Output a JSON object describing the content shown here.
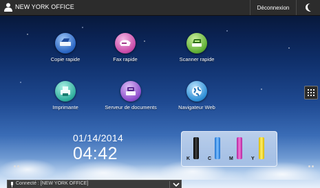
{
  "topbar": {
    "title": "NEW YORK OFFICE",
    "logout_label": "Déconnexion",
    "icons": {
      "user": "user-icon",
      "energy": "moon-icon"
    }
  },
  "apps": [
    {
      "label": "Copie rapide",
      "icon": "copy-icon"
    },
    {
      "label": "Fax rapide",
      "icon": "fax-icon"
    },
    {
      "label": "Scanner rapide",
      "icon": "scanner-icon"
    },
    {
      "label": "Imprimante",
      "icon": "printer-icon"
    },
    {
      "label": "Serveur de documents",
      "icon": "document-server-icon"
    },
    {
      "label": "Navigateur Web",
      "icon": "web-browser-icon"
    }
  ],
  "clock": {
    "date": "01/14/2014",
    "time": "04:42"
  },
  "toner": [
    {
      "label": "K",
      "color": "#000000"
    },
    {
      "label": "C",
      "color": "#1a6fcf"
    },
    {
      "label": "M",
      "color": "#c52ba7"
    },
    {
      "label": "Y",
      "color": "#e6c600"
    }
  ],
  "status": {
    "message": "Connecté : [NEW YORK OFFICE]"
  }
}
